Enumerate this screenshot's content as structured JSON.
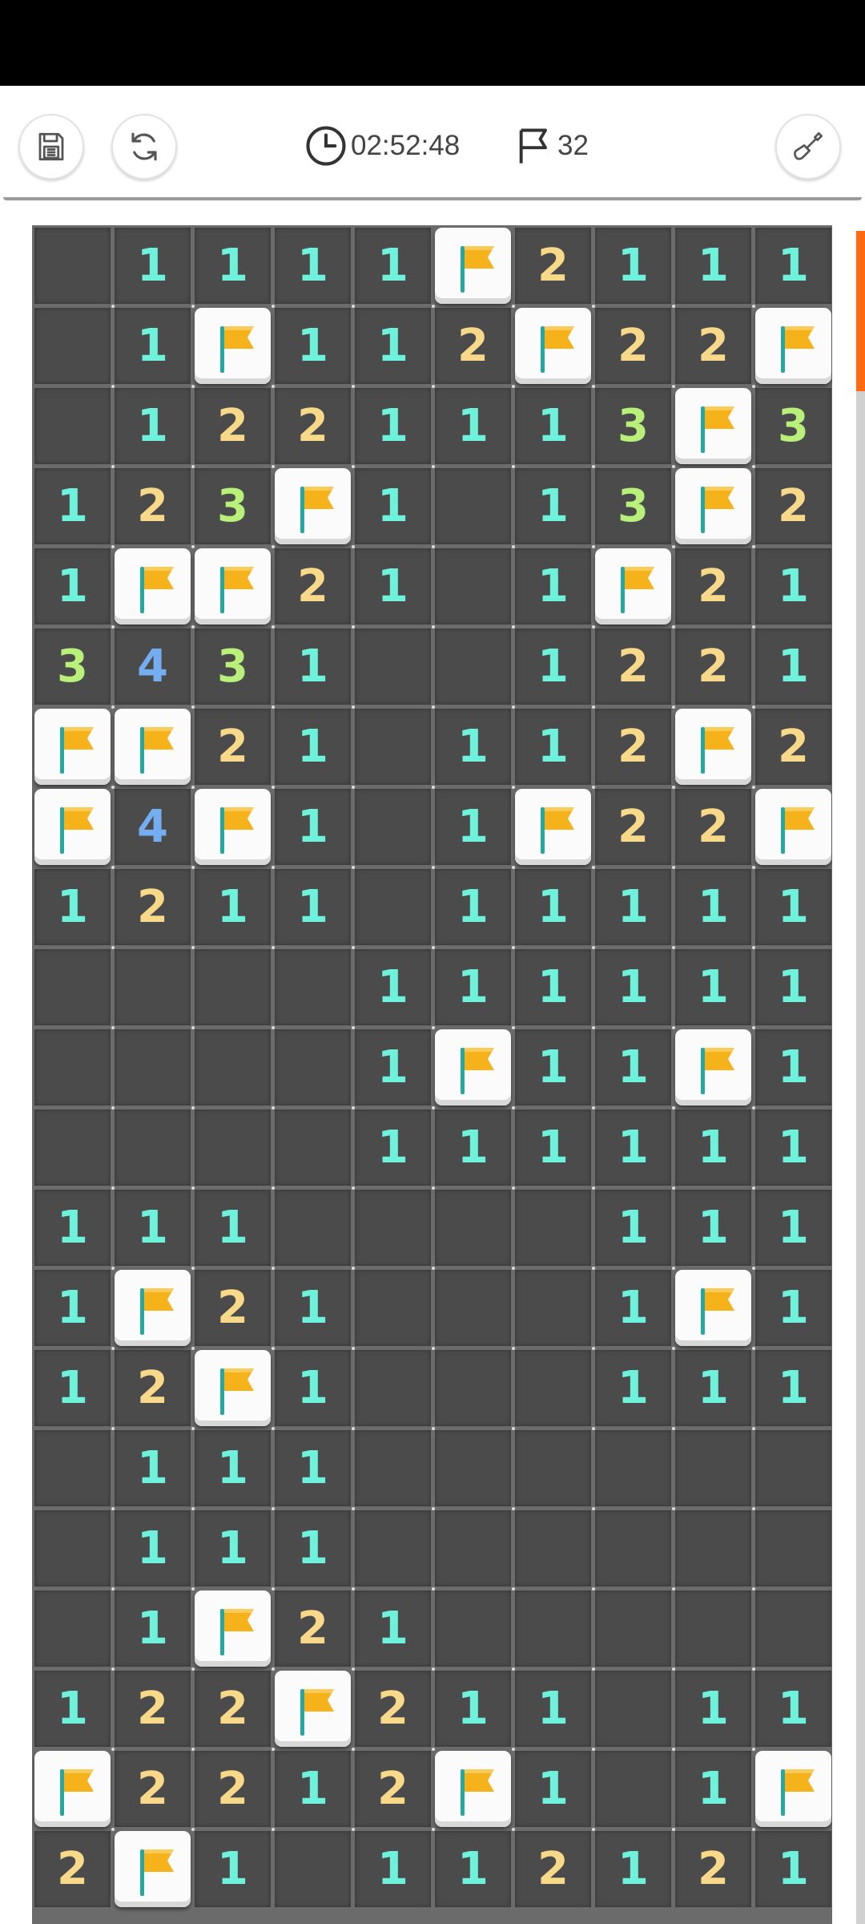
{
  "toolbar": {
    "save_icon": "save-icon",
    "restart_icon": "restart-icon",
    "timer_icon": "clock-icon",
    "timer_value": "02:52:48",
    "flag_icon": "flag-outline-icon",
    "flags_count": "32",
    "tool_icon": "shovel-icon"
  },
  "colors": {
    "board_bg": "#6b6b6b",
    "cell_bg": "#4b4b4b",
    "flag_cell_bg": "#fbfbfb",
    "flag_color": "#f6b21a",
    "num_1": "#6ff2dc",
    "num_2": "#f8d98a",
    "num_3": "#b8f07a",
    "num_4": "#74aef0",
    "scroll_thumb": "#ff6a10"
  },
  "board": {
    "rows": [
      [
        "",
        "1",
        "1",
        "1",
        "1",
        "F",
        "2",
        "1",
        "1",
        "1"
      ],
      [
        "",
        "1",
        "F",
        "1",
        "1",
        "2",
        "F",
        "2",
        "2",
        "F"
      ],
      [
        "",
        "1",
        "2",
        "2",
        "1",
        "1",
        "1",
        "3",
        "F",
        "3"
      ],
      [
        "1",
        "2",
        "3",
        "F",
        "1",
        "",
        "1",
        "3",
        "F",
        "2"
      ],
      [
        "1",
        "F",
        "F",
        "2",
        "1",
        "",
        "1",
        "F",
        "2",
        "1"
      ],
      [
        "3",
        "4",
        "3",
        "1",
        "",
        "",
        "1",
        "2",
        "2",
        "1"
      ],
      [
        "F",
        "F",
        "2",
        "1",
        "",
        "1",
        "1",
        "2",
        "F",
        "2"
      ],
      [
        "F",
        "4",
        "F",
        "1",
        "",
        "1",
        "F",
        "2",
        "2",
        "F"
      ],
      [
        "1",
        "2",
        "1",
        "1",
        "",
        "1",
        "1",
        "1",
        "1",
        "1"
      ],
      [
        "",
        "",
        "",
        "",
        "1",
        "1",
        "1",
        "1",
        "1",
        "1"
      ],
      [
        "",
        "",
        "",
        "",
        "1",
        "F",
        "1",
        "1",
        "F",
        "1"
      ],
      [
        "",
        "",
        "",
        "",
        "1",
        "1",
        "1",
        "1",
        "1",
        "1"
      ],
      [
        "1",
        "1",
        "1",
        "",
        "",
        "",
        "",
        "1",
        "1",
        "1"
      ],
      [
        "1",
        "F",
        "2",
        "1",
        "",
        "",
        "",
        "1",
        "F",
        "1"
      ],
      [
        "1",
        "2",
        "F",
        "1",
        "",
        "",
        "",
        "1",
        "1",
        "1"
      ],
      [
        "",
        "1",
        "1",
        "1",
        "",
        "",
        "",
        "",
        "",
        ""
      ],
      [
        "",
        "1",
        "1",
        "1",
        "",
        "",
        "",
        "",
        "",
        ""
      ],
      [
        "",
        "1",
        "F",
        "2",
        "1",
        "",
        "",
        "",
        "",
        ""
      ],
      [
        "1",
        "2",
        "2",
        "F",
        "2",
        "1",
        "1",
        "",
        "1",
        "1"
      ],
      [
        "F",
        "2",
        "2",
        "1",
        "2",
        "F",
        "1",
        "",
        "1",
        "F"
      ],
      [
        "2",
        "F",
        "1",
        "",
        "1",
        "1",
        "2",
        "1",
        "2",
        "1"
      ]
    ]
  }
}
